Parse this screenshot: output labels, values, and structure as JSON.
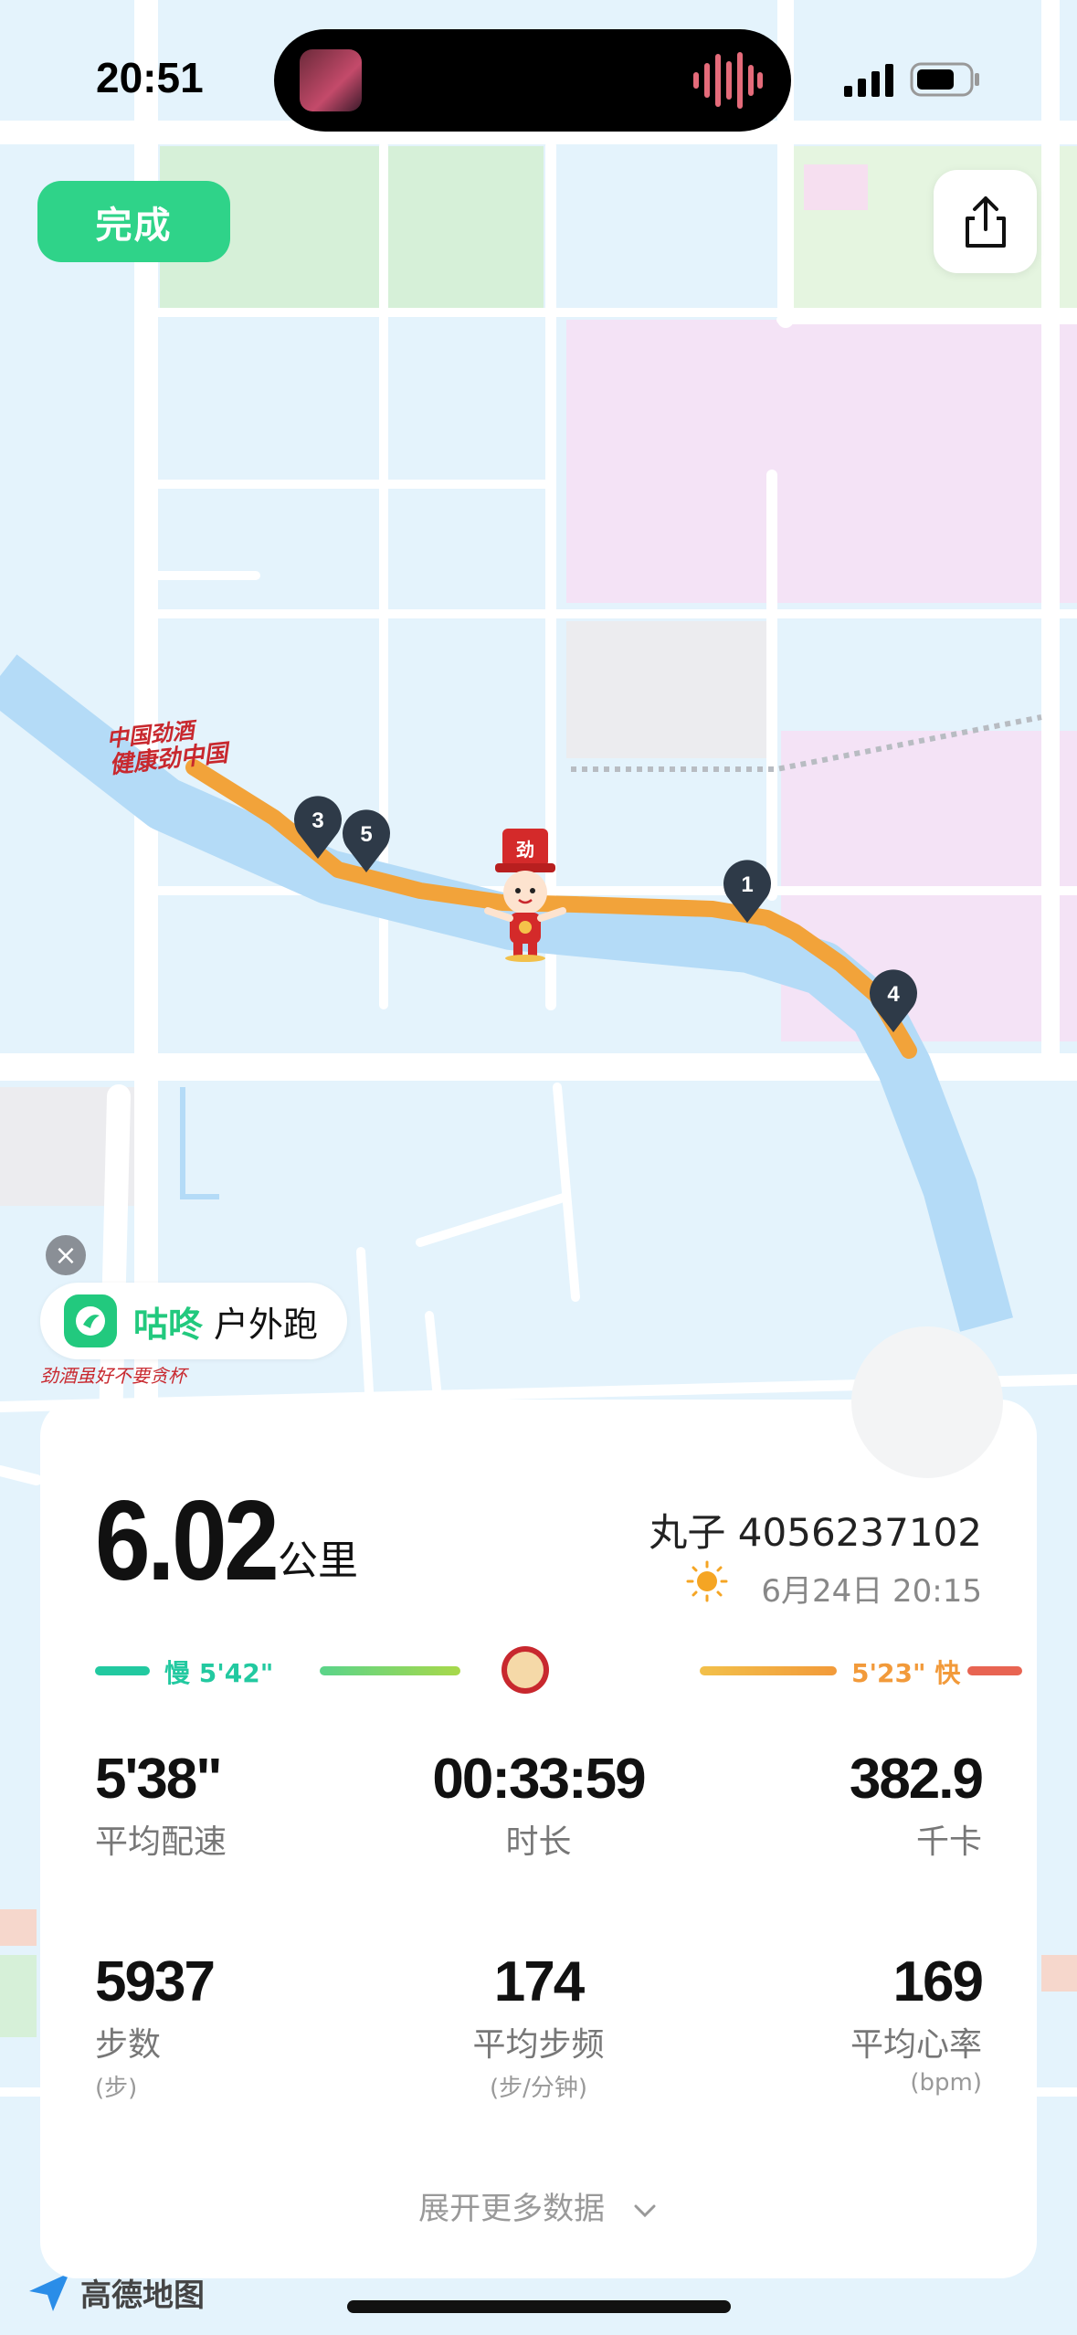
{
  "status_bar": {
    "time": "20:51"
  },
  "header": {
    "done_label": "完成"
  },
  "route_markers": [
    "1",
    "3",
    "4",
    "5"
  ],
  "map_badge": {
    "logo_text_1": "中国劲酒",
    "logo_text_2": "健康劲中国"
  },
  "app_pill": {
    "brand": "咕咚",
    "mode": "户外跑"
  },
  "slogan": "劲酒虽好不要贪杯",
  "summary": {
    "distance_value": "6.02",
    "distance_unit": "公里",
    "user_name": "丸子 4056237102",
    "date": "6月24日 20:15"
  },
  "pace_legend": {
    "slow": "慢 5'42\"",
    "fast": "5'23\" 快"
  },
  "stats": {
    "avg_pace": {
      "value": "5'38\"",
      "label": "平均配速"
    },
    "duration": {
      "value": "00:33:59",
      "label": "时长"
    },
    "calories": {
      "value": "382.9",
      "label": "千卡"
    },
    "steps": {
      "value": "5937",
      "label": "步数",
      "sub": "(步)"
    },
    "cadence": {
      "value": "174",
      "label": "平均步频",
      "sub": "(步/分钟)"
    },
    "heart_rate": {
      "value": "169",
      "label": "平均心率",
      "sub": "(bpm)"
    }
  },
  "expand_label": "展开更多数据",
  "map_provider": "高德地图",
  "colors": {
    "accent_green": "#2fd389",
    "route_orange": "#f2a33a",
    "slow_color": "#22c9a0",
    "fast_color": "#e86452"
  }
}
